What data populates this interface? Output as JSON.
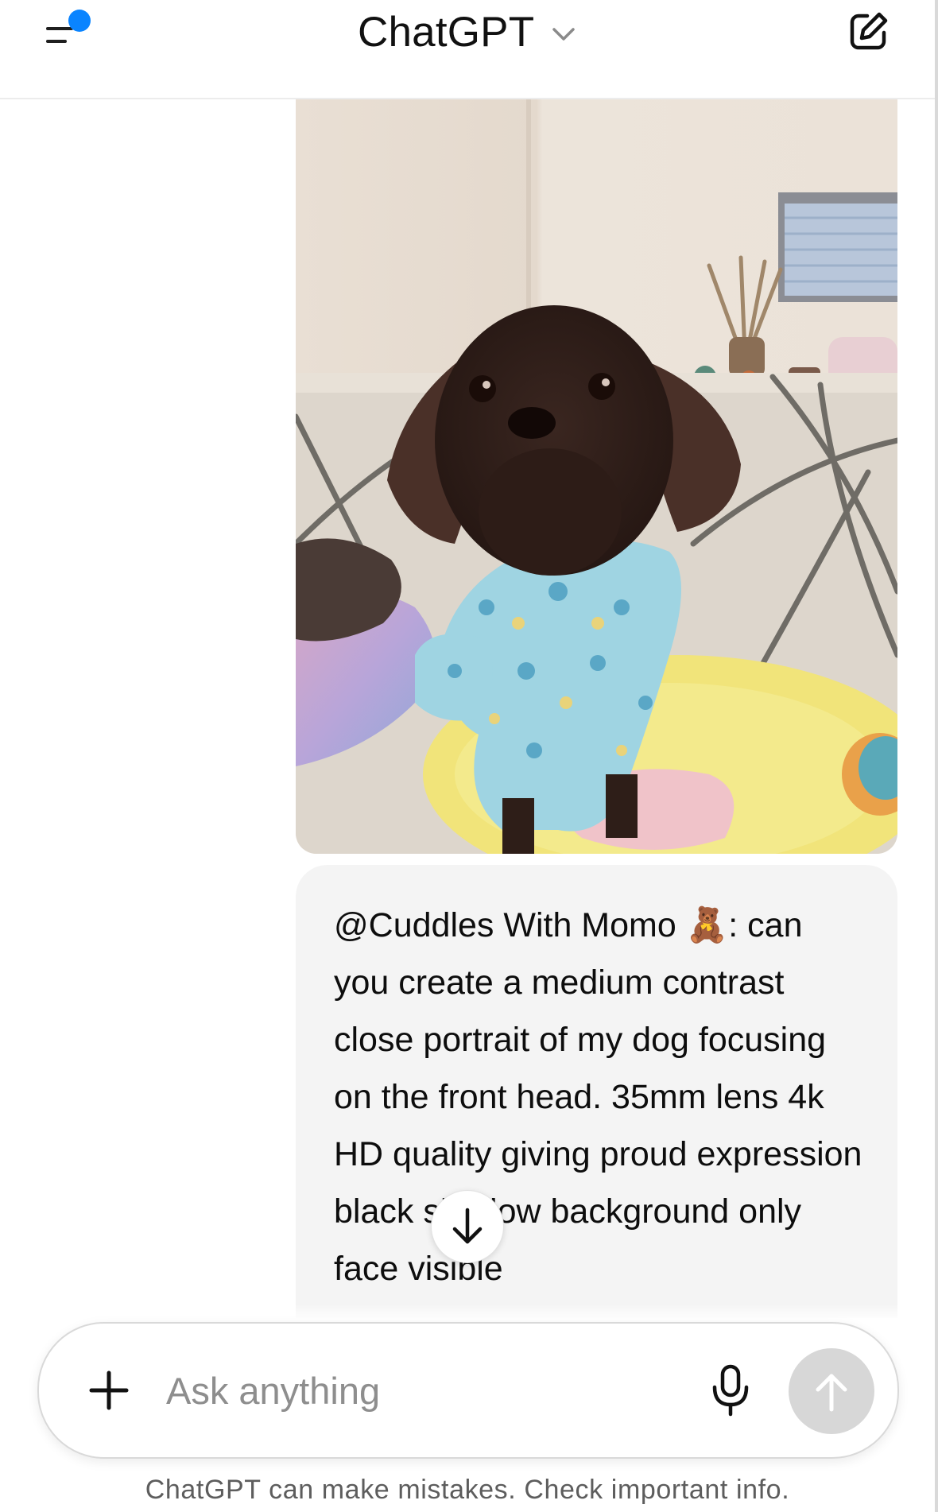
{
  "header": {
    "model_name": "ChatGPT",
    "menu_icon": "sidebar-menu-icon",
    "new_chat_icon": "compose-icon",
    "notification_color": "#0a84ff"
  },
  "conversation": {
    "user_image": {
      "subject": "small brown dog in light blue pajamas sitting on a yellow cushion on a sofa"
    },
    "user_message": {
      "mention": "@Cuddles With Momo 🧸:",
      "text": "can you create a medium contrast close portrait of my dog focusing on the front head. 35mm lens 4k HD quality giving proud expression black shadow background only face visible"
    }
  },
  "scroll_down": {
    "icon": "arrow-down-icon"
  },
  "composer": {
    "placeholder": "Ask anything",
    "add_icon": "plus-icon",
    "mic_icon": "microphone-icon",
    "send_icon": "arrow-up-icon"
  },
  "footer": {
    "disclaimer": "ChatGPT can make mistakes. Check important info."
  },
  "colors": {
    "bubble_bg": "#f4f4f4",
    "send_disabled": "#d7d7d7",
    "placeholder": "#8e8e8e"
  }
}
